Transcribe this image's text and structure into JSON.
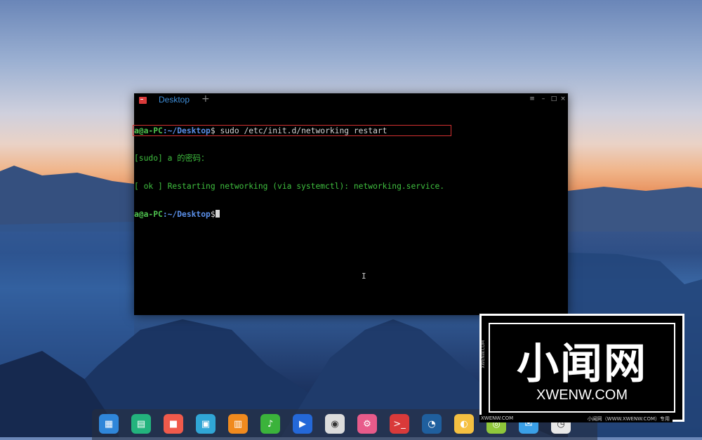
{
  "terminal": {
    "tab_label": "Desktop",
    "new_tab_symbol": "+",
    "menu_symbol": "≡",
    "minimize_symbol": "–",
    "maximize_symbol": "□",
    "close_symbol": "×",
    "lines": [
      {
        "user": "a@a-PC",
        "path": ":~/Desktop",
        "dollar": "$",
        "command": " sudo /etc/init.d/networking restart"
      },
      {
        "output": "[sudo] a 的密码："
      },
      {
        "output": "[ ok ] Restarting networking (via systemctl): networking.service."
      },
      {
        "user": "a@a-PC",
        "path": ":~/Desktop",
        "dollar": "$",
        "command": ""
      }
    ],
    "ibeam_symbol": "I"
  },
  "dock": {
    "items": [
      {
        "name": "launcher-icon",
        "color": "#2f86d9",
        "glyph": "▦"
      },
      {
        "name": "file-manager-icon",
        "color": "#23b37d",
        "glyph": "▤"
      },
      {
        "name": "screen-recorder-icon",
        "color": "#f05a4b",
        "glyph": "■"
      },
      {
        "name": "app-store-icon",
        "color": "#30a6d6",
        "glyph": "▣"
      },
      {
        "name": "shop-icon",
        "color": "#f08a1e",
        "glyph": "▥"
      },
      {
        "name": "music-icon",
        "color": "#3bb33b",
        "glyph": "♪"
      },
      {
        "name": "video-icon",
        "color": "#2468d8",
        "glyph": "▶"
      },
      {
        "name": "chrome-icon",
        "color": "#dcdcdc",
        "glyph": "◉"
      },
      {
        "name": "settings-icon",
        "color": "#e85b8a",
        "glyph": "⚙"
      },
      {
        "name": "terminal-icon",
        "color": "#d93a3a",
        "glyph": ">_"
      },
      {
        "name": "assistant-icon",
        "color": "#1f5f9e",
        "glyph": "◔"
      },
      {
        "name": "browser-icon",
        "color": "#f5c041",
        "glyph": "◐"
      },
      {
        "name": "media-icon",
        "color": "#8fc73b",
        "glyph": "◎"
      },
      {
        "name": "mail-icon",
        "color": "#3aa0e8",
        "glyph": "✉"
      },
      {
        "name": "clock-icon",
        "color": "#e8e8e8",
        "glyph": "◷"
      }
    ]
  },
  "watermark": {
    "chinese": "小闻网",
    "domain": "XWENW.COM",
    "vertical": "XWENW.COM",
    "strip_left": "XWENW.COM",
    "strip_right": "小闻网（WWW.XWENW.COM）专用"
  }
}
